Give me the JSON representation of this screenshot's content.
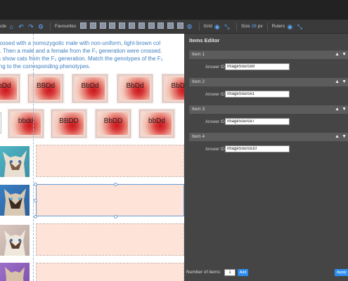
{
  "toolbar": {
    "left_label": "ute",
    "favourites_label": "Favourites",
    "grid_label": "Grid",
    "size_label": "Size",
    "size_value": "28",
    "size_unit": "px",
    "rulers_label": "Rulers"
  },
  "canvas": {
    "prompt_lines": [
      "rossed with a homozygotic male with non-uniform, light-brown col",
      "). Then a male and a female from the F₁ generation were crossed.",
      "s show cats from the F₂ generation. Match the genotypes of the F₂",
      "ing to the corresponding phenotypes."
    ],
    "tiles_row1": [
      "BbDd",
      "BBDd",
      "BbDd",
      "BbDd",
      "BbDd"
    ],
    "tiles_row2": [
      "bbdd",
      "BBDD",
      "BbDD",
      "bbDd"
    ]
  },
  "panel": {
    "title": "Items Editor",
    "answer_id_label": "Answer ID",
    "items": [
      {
        "name": "Item 1",
        "answer_id": "ImageSource9"
      },
      {
        "name": "Item 2",
        "answer_id": "ImageSource1"
      },
      {
        "name": "Item 3",
        "answer_id": "ImageSource7"
      },
      {
        "name": "Item 4",
        "answer_id": "ImageSource10"
      }
    ],
    "number_of_items_label": "Number of items:",
    "number_of_items_value": "1",
    "add_label": "Add",
    "apply_label": "Apply"
  },
  "colors": {
    "accent": "#2d8ef0",
    "panel_bg": "#454545",
    "prompt_text": "#3d7fc0",
    "drop_zone": "#fde3d8"
  }
}
